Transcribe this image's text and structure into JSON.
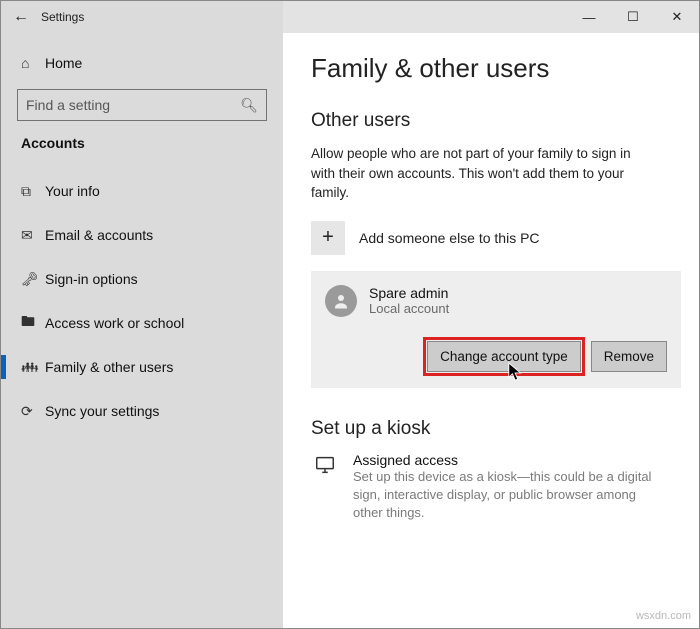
{
  "app": {
    "title": "Settings"
  },
  "sidebar": {
    "home_label": "Home",
    "search_placeholder": "Find a setting",
    "category_title": "Accounts",
    "items": [
      {
        "label": "Your info"
      },
      {
        "label": "Email & accounts"
      },
      {
        "label": "Sign-in options"
      },
      {
        "label": "Access work or school"
      },
      {
        "label": "Family & other users"
      },
      {
        "label": "Sync your settings"
      }
    ],
    "active_index": 4
  },
  "page": {
    "title": "Family & other users",
    "other_users": {
      "heading": "Other users",
      "description": "Allow people who are not part of your family to sign in with their own accounts. This won't add them to your family.",
      "add_label": "Add someone else to this PC",
      "account": {
        "name": "Spare admin",
        "type": "Local account"
      },
      "change_btn": "Change account type",
      "remove_btn": "Remove"
    },
    "kiosk": {
      "heading": "Set up a kiosk",
      "title": "Assigned access",
      "description": "Set up this device as a kiosk—this could be a digital sign, interactive display, or public browser among other things."
    }
  },
  "watermark": "wsxdn.com"
}
